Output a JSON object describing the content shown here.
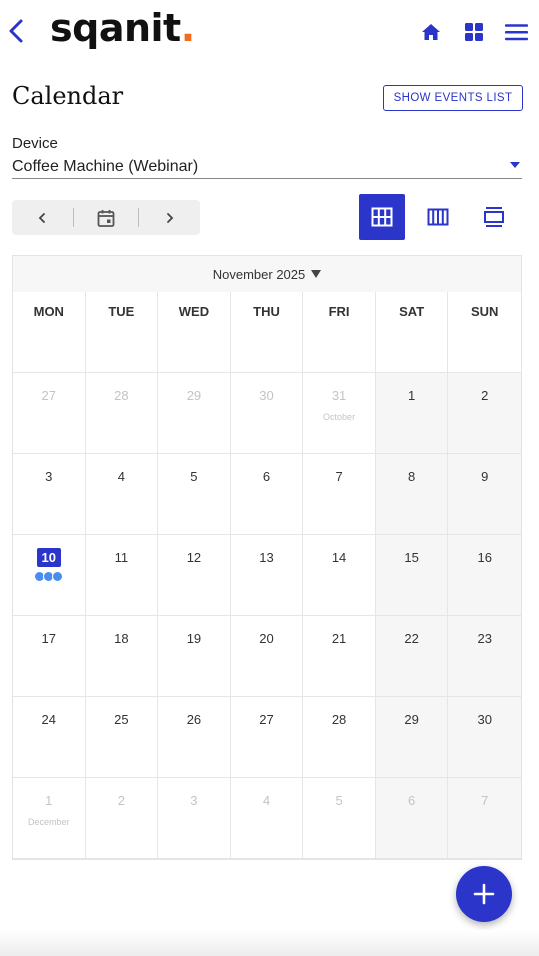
{
  "header": {
    "logo_text": "sqanit",
    "logo_dot": ".",
    "icons": [
      "back-arrow-icon",
      "home-icon",
      "apps-grid-icon",
      "hamburger-menu-icon"
    ]
  },
  "page": {
    "title": "Calendar",
    "events_button": "SHOW EVENTS LIST"
  },
  "device": {
    "label": "Device",
    "value": "Coffee Machine (Webinar)"
  },
  "calendar": {
    "month": "November 2025",
    "weekdays": [
      "MON",
      "TUE",
      "WED",
      "THU",
      "FRI",
      "SAT",
      "SUN"
    ],
    "days": [
      {
        "d": "27",
        "other": true
      },
      {
        "d": "28",
        "other": true
      },
      {
        "d": "29",
        "other": true
      },
      {
        "d": "30",
        "other": true
      },
      {
        "d": "31",
        "other": true,
        "sub": "October"
      },
      {
        "d": "1"
      },
      {
        "d": "2"
      },
      {
        "d": "3"
      },
      {
        "d": "4"
      },
      {
        "d": "5"
      },
      {
        "d": "6"
      },
      {
        "d": "7"
      },
      {
        "d": "8"
      },
      {
        "d": "9"
      },
      {
        "d": "10",
        "today": true,
        "events": 3
      },
      {
        "d": "11"
      },
      {
        "d": "12"
      },
      {
        "d": "13"
      },
      {
        "d": "14"
      },
      {
        "d": "15"
      },
      {
        "d": "16"
      },
      {
        "d": "17"
      },
      {
        "d": "18"
      },
      {
        "d": "19"
      },
      {
        "d": "20"
      },
      {
        "d": "21"
      },
      {
        "d": "22"
      },
      {
        "d": "23"
      },
      {
        "d": "24"
      },
      {
        "d": "25"
      },
      {
        "d": "26"
      },
      {
        "d": "27"
      },
      {
        "d": "28"
      },
      {
        "d": "29"
      },
      {
        "d": "30"
      },
      {
        "d": "1",
        "other": true,
        "sub": "December"
      },
      {
        "d": "2",
        "other": true
      },
      {
        "d": "3",
        "other": true
      },
      {
        "d": "4",
        "other": true
      },
      {
        "d": "5",
        "other": true
      },
      {
        "d": "6",
        "other": true
      },
      {
        "d": "7",
        "other": true
      }
    ]
  },
  "colors": {
    "accent": "#2b35c9",
    "logo_dot": "#f26b21",
    "event_dot": "#4a8df0"
  }
}
